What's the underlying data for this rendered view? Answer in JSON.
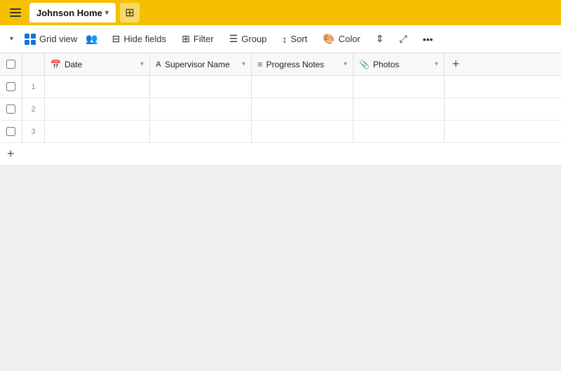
{
  "titleBar": {
    "appName": "Johnson Home",
    "dropdownArrow": "▾",
    "addTabIcon": "+"
  },
  "toolbar": {
    "viewDropdownArrow": "▾",
    "gridViewLabel": "Grid view",
    "hideFieldsLabel": "Hide fields",
    "filterLabel": "Filter",
    "groupLabel": "Group",
    "sortLabel": "Sort",
    "colorLabel": "Color",
    "moreOptionsIcon": "•••"
  },
  "table": {
    "columns": [
      {
        "id": "date",
        "label": "Date",
        "icon": "📅",
        "iconType": "date"
      },
      {
        "id": "supervisor",
        "label": "Supervisor Name",
        "icon": "A",
        "iconType": "text"
      },
      {
        "id": "notes",
        "label": "Progress Notes",
        "icon": "≡",
        "iconType": "long-text"
      },
      {
        "id": "photos",
        "label": "Photos",
        "icon": "🖼",
        "iconType": "attachment"
      }
    ],
    "rows": [
      {
        "num": "1",
        "date": "",
        "supervisor": "",
        "notes": "",
        "photos": ""
      },
      {
        "num": "2",
        "date": "",
        "supervisor": "",
        "notes": "",
        "photos": ""
      },
      {
        "num": "3",
        "date": "",
        "supervisor": "",
        "notes": "",
        "photos": ""
      }
    ],
    "addRowLabel": "+",
    "addColumnLabel": "+"
  }
}
